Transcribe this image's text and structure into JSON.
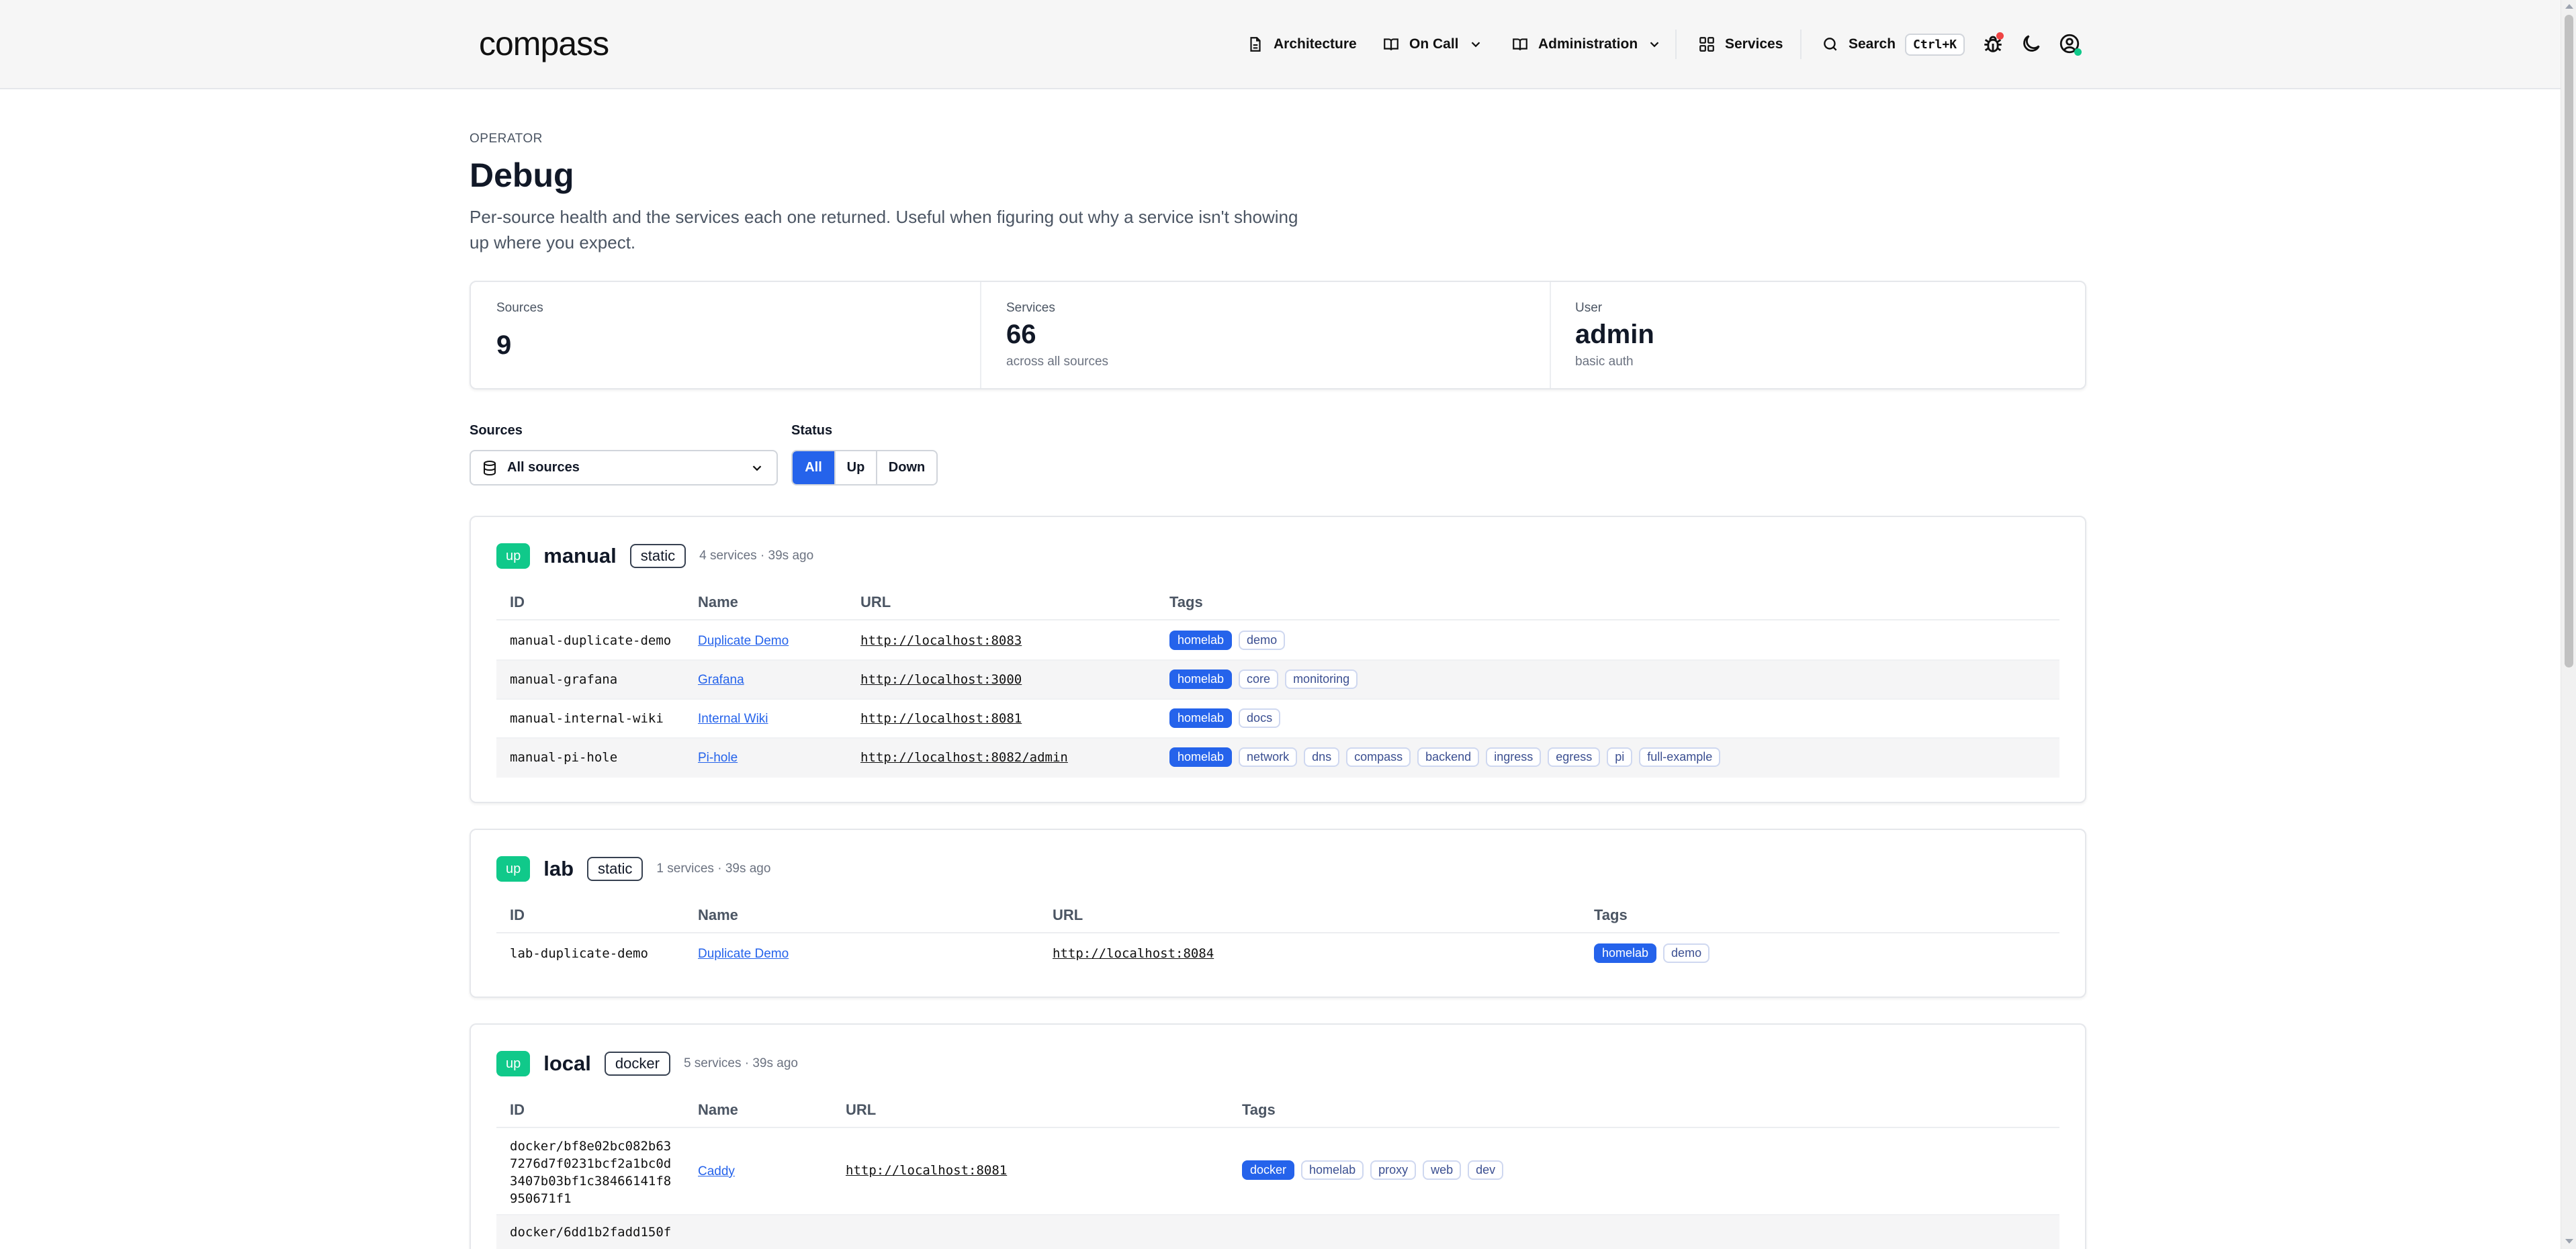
{
  "header": {
    "logo": "compass",
    "nav": {
      "architecture": "Architecture",
      "on_call": "On Call",
      "administration": "Administration",
      "services": "Services",
      "search": "Search",
      "search_shortcut": "Ctrl+K"
    }
  },
  "page": {
    "eyebrow": "OPERATOR",
    "title": "Debug",
    "subtitle": "Per-source health and the services each one returned. Useful when figuring out why a service isn't showing up where you expect."
  },
  "stats": {
    "sources": {
      "label": "Sources",
      "value": "9"
    },
    "services": {
      "label": "Services",
      "value": "66",
      "sub": "across all sources"
    },
    "user": {
      "label": "User",
      "value": "admin",
      "sub": "basic auth"
    }
  },
  "filters": {
    "sources_label": "Sources",
    "sources_value": "All sources",
    "status_label": "Status",
    "status_options": [
      "All",
      "Up",
      "Down"
    ],
    "status_selected": "All"
  },
  "columns": {
    "id": "ID",
    "name": "Name",
    "url": "URL",
    "tags": "Tags"
  },
  "sources": [
    {
      "status": "up",
      "name": "manual",
      "type": "static",
      "meta": "4 services · 39s ago",
      "rows": [
        {
          "id": "manual-duplicate-demo",
          "name": "Duplicate Demo",
          "url": "http://localhost:8083",
          "tags": [
            "homelab",
            "demo"
          ]
        },
        {
          "id": "manual-grafana",
          "name": "Grafana",
          "url": "http://localhost:3000",
          "tags": [
            "homelab",
            "core",
            "monitoring"
          ]
        },
        {
          "id": "manual-internal-wiki",
          "name": "Internal Wiki",
          "url": "http://localhost:8081",
          "tags": [
            "homelab",
            "docs"
          ]
        },
        {
          "id": "manual-pi-hole",
          "name": "Pi-hole",
          "url": "http://localhost:8082/admin",
          "tags": [
            "homelab",
            "network",
            "dns",
            "compass",
            "backend",
            "ingress",
            "egress",
            "pi",
            "full-example"
          ]
        }
      ]
    },
    {
      "status": "up",
      "name": "lab",
      "type": "static",
      "meta": "1 services · 39s ago",
      "rows": [
        {
          "id": "lab-duplicate-demo",
          "name": "Duplicate Demo",
          "url": "http://localhost:8084",
          "tags": [
            "homelab",
            "demo"
          ]
        }
      ]
    },
    {
      "status": "up",
      "name": "local",
      "type": "docker",
      "meta": "5 services · 39s ago",
      "rows": [
        {
          "id_lines": [
            "docker/bf8e02bc082b63",
            "7276d7f0231bcf2a1bc0d",
            "3407b03bf1c38466141f8",
            "950671f1"
          ],
          "name": "Caddy",
          "url": "http://localhost:8081",
          "tags": [
            "docker",
            "homelab",
            "proxy",
            "web",
            "dev"
          ]
        },
        {
          "id_lines": [
            "docker/6dd1b2fadd150f"
          ],
          "name": "",
          "url": "",
          "tags": []
        }
      ]
    }
  ]
}
